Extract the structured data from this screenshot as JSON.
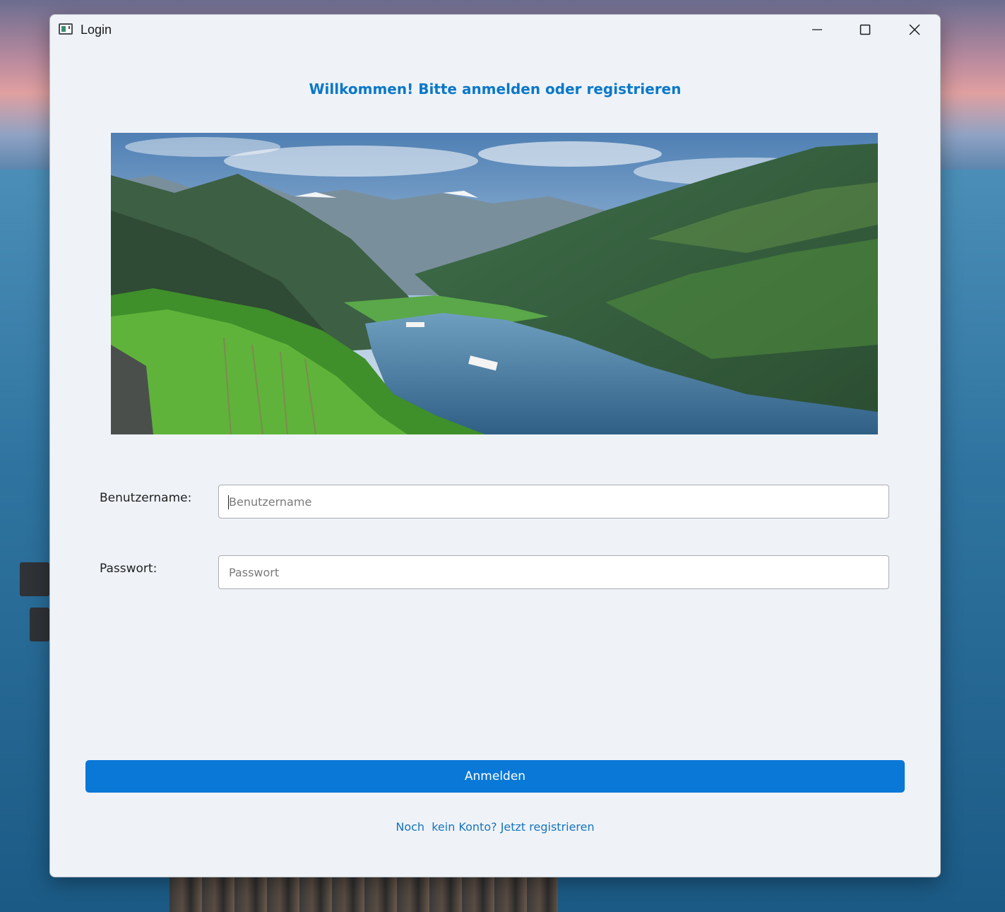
{
  "window": {
    "title": "Login"
  },
  "header": {
    "welcome": "Willkommen! Bitte anmelden oder registrieren"
  },
  "form": {
    "username_label": "Benutzername:",
    "username_placeholder": "Benutzername",
    "password_label": "Passwort:",
    "password_placeholder": "Passwort"
  },
  "actions": {
    "login_label": "Anmelden",
    "register_link": "Noch  kein Konto? Jetzt registrieren"
  },
  "colors": {
    "accent": "#0a78d7",
    "welcome_text": "#0b78c8",
    "link": "#1674bd",
    "window_bg": "#eff3f8"
  },
  "icons": {
    "app": "window-app-icon",
    "minimize": "minimize-icon",
    "maximize": "maximize-icon",
    "close": "close-icon"
  }
}
